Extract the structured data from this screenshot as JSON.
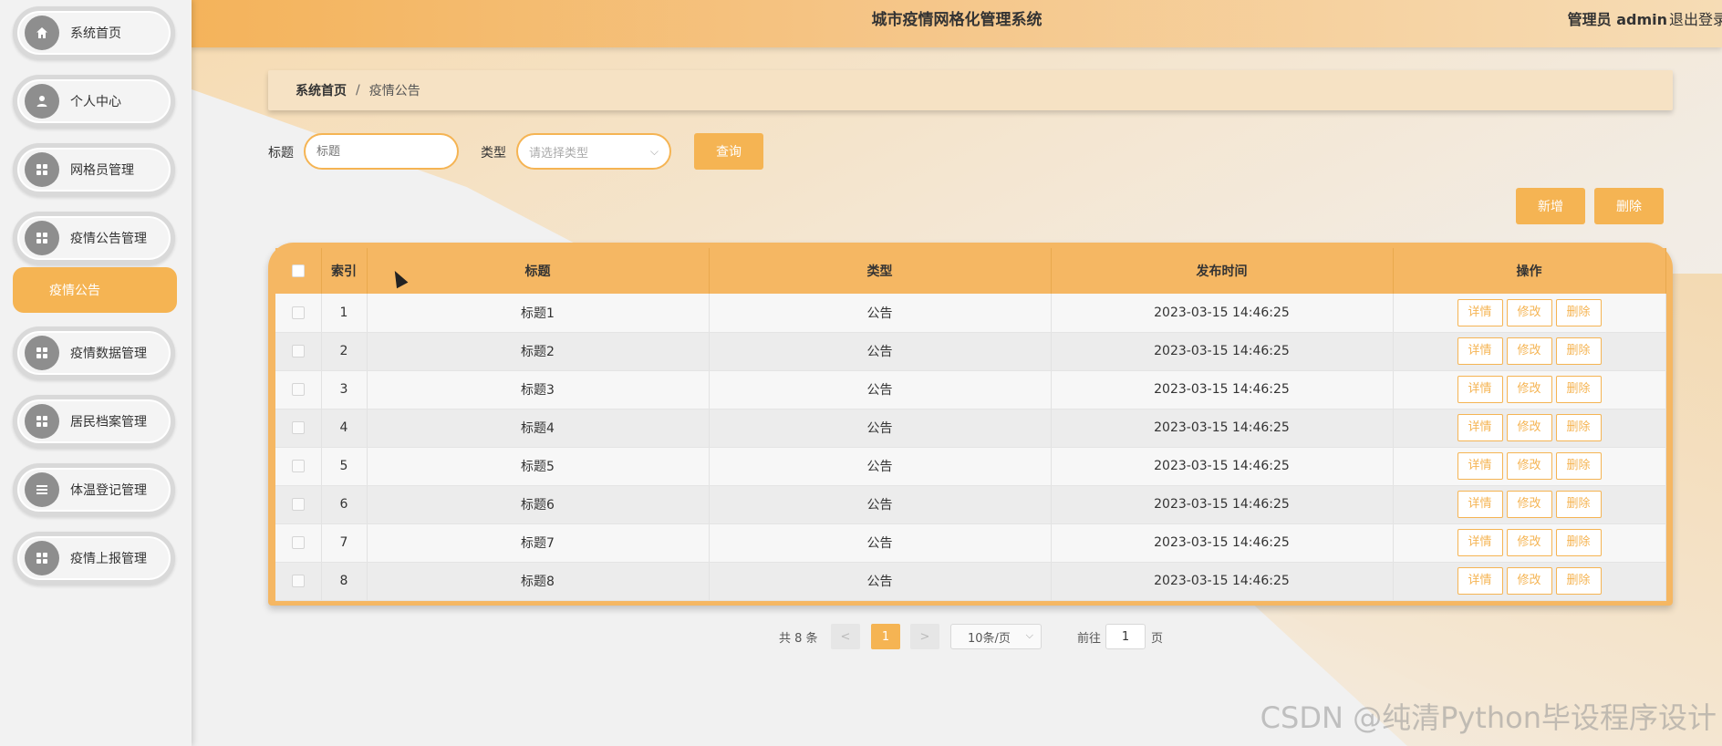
{
  "header": {
    "title": "城市疫情网格化管理系统",
    "user": "管理员 admin",
    "logout": "退出登录"
  },
  "sidebar": {
    "items": [
      {
        "label": "系统首页",
        "icon": "home-icon"
      },
      {
        "label": "个人中心",
        "icon": "user-icon"
      },
      {
        "label": "网格员管理",
        "icon": "grid-icon"
      },
      {
        "label": "疫情公告管理",
        "icon": "grid-icon"
      },
      {
        "label": "疫情数据管理",
        "icon": "grid-icon"
      },
      {
        "label": "居民档案管理",
        "icon": "grid-icon"
      },
      {
        "label": "体温登记管理",
        "icon": "list-icon"
      },
      {
        "label": "疫情上报管理",
        "icon": "grid-icon"
      }
    ],
    "submenu_label": "疫情公告"
  },
  "breadcrumb": {
    "home": "系统首页",
    "separator": "/",
    "current": "疫情公告"
  },
  "search": {
    "title_label": "标题",
    "title_placeholder": "标题",
    "type_label": "类型",
    "type_placeholder": "请选择类型",
    "query_button": "查询"
  },
  "actions": {
    "add": "新增",
    "delete": "删除"
  },
  "table": {
    "columns": [
      "索引",
      "标题",
      "类型",
      "发布时间",
      "操作"
    ],
    "rows": [
      {
        "index": "1",
        "title": "标题1",
        "type": "公告",
        "time": "2023-03-15 14:46:25"
      },
      {
        "index": "2",
        "title": "标题2",
        "type": "公告",
        "time": "2023-03-15 14:46:25"
      },
      {
        "index": "3",
        "title": "标题3",
        "type": "公告",
        "time": "2023-03-15 14:46:25"
      },
      {
        "index": "4",
        "title": "标题4",
        "type": "公告",
        "time": "2023-03-15 14:46:25"
      },
      {
        "index": "5",
        "title": "标题5",
        "type": "公告",
        "time": "2023-03-15 14:46:25"
      },
      {
        "index": "6",
        "title": "标题6",
        "type": "公告",
        "time": "2023-03-15 14:46:25"
      },
      {
        "index": "7",
        "title": "标题7",
        "type": "公告",
        "time": "2023-03-15 14:46:25"
      },
      {
        "index": "8",
        "title": "标题8",
        "type": "公告",
        "time": "2023-03-15 14:46:25"
      }
    ],
    "row_actions": {
      "detail": "详情",
      "edit": "修改",
      "delete": "删除"
    }
  },
  "pagination": {
    "total": "共 8 条",
    "prev": "<",
    "current_page": "1",
    "next": ">",
    "page_size": "10条/页",
    "goto_label": "前往",
    "goto_value": "1",
    "page_suffix": "页"
  },
  "watermark": "CSDN @纯清Python毕设程序设计",
  "colors": {
    "accent": "#f5b453",
    "header_start": "#f4b35b",
    "header_end": "#f6dcb5"
  }
}
